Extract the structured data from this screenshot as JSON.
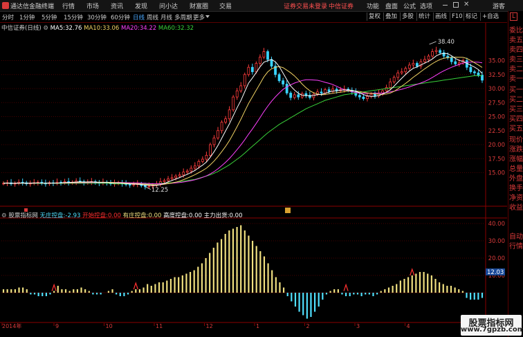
{
  "menubar": {
    "app_title": "通达信金融终端",
    "items": [
      "行情",
      "市场",
      "资讯",
      "发现",
      "问小达",
      "财富圈",
      "交易"
    ],
    "status_login": "证券交易未登录",
    "broker": "中信证券",
    "right_items": [
      "功能",
      "盘面",
      "公式",
      "选项"
    ],
    "guest": "游客"
  },
  "toolbar": {
    "periods": [
      "分时",
      "1分钟",
      "5分钟",
      "15分钟",
      "30分钟",
      "60分钟",
      "日线",
      "周线",
      "月线",
      "多周期",
      "更多"
    ],
    "active_period": "日线",
    "right_buttons": [
      "复权",
      "叠加",
      "多股",
      "统计",
      "画线",
      "F10",
      "标记",
      "+自选"
    ]
  },
  "legend": {
    "stock_name": "中信证券(日线)",
    "ma5_label": "MA5:",
    "ma5_value": "32.76",
    "ma10_label": "MA10:",
    "ma10_value": "33.06",
    "ma20_label": "MA20:",
    "ma20_value": "34.22",
    "ma60_label": "MA60:",
    "ma60_value": "32.32",
    "colors": {
      "ma5": "#ffffff",
      "ma10": "#f0d264",
      "ma20": "#ff40ff",
      "ma60": "#3ad23a"
    }
  },
  "indicator": {
    "name": "股票指标网",
    "l1": "无庄控盘:",
    "v1": "-2.93",
    "l2": "开始控盘:",
    "v2": "0.00",
    "l3": "有庄控盘:",
    "v3": "0.00",
    "l4": "高度控盘:",
    "v4": "0.00",
    "l5": "主力出货:",
    "v5": "0.00",
    "current_value": "12.03"
  },
  "annotations": {
    "high": "38.40",
    "low": "12.25"
  },
  "right_panel": [
    "委比",
    "卖五",
    "卖四",
    "卖三",
    "卖二",
    "卖一",
    "买一",
    "买二",
    "买三",
    "买四",
    "买五",
    "现价",
    "涨跌",
    "涨幅",
    "总量",
    "外盘",
    "换手",
    "净资",
    "收益",
    "自动",
    "行情"
  ],
  "watermark": {
    "line1": "股票指标网",
    "line2": "www.7gpzb.com"
  },
  "chart_data": [
    {
      "type": "line",
      "title": "中信证券(日线)",
      "ylim": [
        10,
        40
      ],
      "y_ticks": [
        "35.00",
        "32.50",
        "30.00",
        "27.50",
        "25.00",
        "22.50",
        "20.00",
        "17.50",
        "15.00"
      ],
      "x_ticks": [
        "2014年",
        "9",
        "10",
        "11",
        "12",
        "1",
        "2",
        "3",
        "4"
      ],
      "grid": true,
      "close": [
        13.1,
        13.2,
        13.0,
        13.1,
        13.3,
        13.2,
        13.0,
        13.1,
        13.2,
        13.3,
        13.1,
        13.0,
        13.2,
        13.1,
        13.3,
        13.2,
        13.4,
        13.2,
        13.3,
        13.5,
        13.4,
        13.2,
        13.3,
        13.4,
        13.2,
        13.1,
        13.3,
        13.2,
        13.0,
        13.1,
        13.2,
        13.0,
        12.9,
        12.8,
        12.9,
        13.0,
        12.7,
        12.5,
        12.6,
        12.8,
        13.0,
        13.4,
        13.6,
        13.9,
        14.1,
        14.4,
        14.6,
        15.1,
        15.3,
        15.8,
        16.2,
        17.0,
        17.4,
        18.1,
        20.0,
        21.2,
        22.5,
        24.0,
        24.6,
        26.2,
        28.5,
        29.6,
        30.5,
        32.5,
        33.8,
        33.0,
        34.5,
        35.6,
        36.6,
        35.2,
        34.0,
        32.5,
        31.4,
        30.8,
        29.2,
        28.4,
        28.9,
        28.5,
        29.1,
        28.8,
        28.4,
        29.0,
        29.4,
        29.2,
        29.8,
        29.5,
        29.9,
        29.6,
        29.8,
        29.9,
        29.7,
        29.4,
        28.8,
        28.5,
        28.2,
        28.6,
        29.0,
        28.7,
        29.2,
        29.6,
        30.2,
        31.2,
        32.0,
        32.8,
        33.0,
        33.6,
        34.2,
        34.5,
        34.0,
        34.8,
        35.2,
        35.8,
        36.6,
        36.8,
        36.4,
        35.8,
        35.5,
        34.8,
        34.4,
        34.6,
        35.0,
        33.8,
        33.0,
        32.8,
        32.4,
        31.5
      ],
      "ma60": [
        13.2,
        13.1,
        13.1,
        13.1,
        13.1,
        13.1,
        13.1,
        13.1,
        13.1,
        13.1,
        13.1,
        13.1,
        13.1,
        13.1,
        13.1,
        13.1,
        13.1,
        13.1,
        13.1,
        13.1,
        13.1,
        13.1,
        13.1,
        13.1,
        13.1,
        13.1,
        13.1,
        13.1,
        13.1,
        13.0,
        13.0,
        13.0,
        13.0,
        13.0,
        13.0,
        13.0,
        13.0,
        13.0,
        13.0,
        13.0,
        13.0,
        13.1,
        13.1,
        13.2,
        13.2,
        13.3,
        13.4,
        13.5,
        13.6,
        13.7,
        13.8,
        14.0,
        14.2,
        14.4,
        14.6,
        14.9,
        15.2,
        15.6,
        16.0,
        16.4,
        16.9,
        17.4,
        17.9,
        18.5,
        19.1,
        19.7,
        20.3,
        20.9,
        21.5,
        22.1,
        22.6,
        23.1,
        23.6,
        24.0,
        24.4,
        24.8,
        25.2,
        25.6,
        26.0,
        26.4,
        26.7,
        27.0,
        27.3,
        27.6,
        27.9,
        28.1,
        28.3,
        28.5,
        28.7,
        28.9,
        29.0,
        29.1,
        29.2,
        29.3,
        29.4,
        29.5,
        29.6,
        29.7,
        29.8,
        29.9,
        30.0,
        30.1,
        30.2,
        30.3,
        30.4,
        30.5,
        30.6,
        30.7,
        30.8,
        30.9,
        31.0,
        31.1,
        31.2,
        31.3,
        31.4,
        31.5,
        31.6,
        31.7,
        31.8,
        31.9,
        32.0,
        32.1,
        32.2,
        32.3,
        32.3,
        32.3
      ]
    },
    {
      "type": "bar",
      "title": "股票指标网",
      "ylim": [
        -20,
        40
      ],
      "y_ticks": [
        "40.00",
        "30.00",
        "20.00",
        "10.00"
      ],
      "values": [
        2,
        2,
        2,
        2,
        3,
        3,
        2,
        -1,
        -1,
        -2,
        -2,
        -2,
        -1,
        1,
        4,
        2,
        2,
        1,
        2,
        2,
        3,
        2,
        1,
        -1,
        -1,
        -1,
        0,
        1,
        2,
        -1,
        -2,
        -2,
        -1,
        1,
        2,
        2,
        3,
        5,
        4,
        5,
        6,
        6,
        7,
        8,
        9,
        9,
        10,
        11,
        12,
        13,
        15,
        17,
        20,
        23,
        26,
        29,
        31,
        34,
        36,
        37,
        38,
        39,
        36,
        33,
        30,
        27,
        24,
        21,
        17,
        13,
        9,
        6,
        3,
        -2,
        -5,
        -8,
        -11,
        -13,
        -15,
        -14,
        -11,
        -8,
        -4,
        -1,
        1,
        2,
        2,
        -1,
        -2,
        -2,
        -1,
        -1,
        -2,
        -1,
        -1,
        -2,
        -1,
        1,
        2,
        3,
        4,
        5,
        7,
        8,
        9,
        10,
        11,
        12,
        12,
        11,
        10,
        8,
        6,
        5,
        4,
        4,
        3,
        2,
        1,
        -3,
        -4,
        -4,
        -4,
        -3
      ],
      "signal_indices": [
        13,
        34,
        88,
        105
      ]
    }
  ]
}
